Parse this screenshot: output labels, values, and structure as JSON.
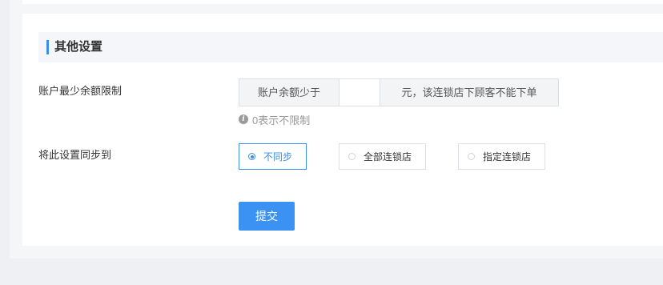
{
  "section": {
    "title": "其他设置"
  },
  "balance_limit": {
    "label": "账户最少余额限制",
    "prefix": "账户余额少于",
    "value": "",
    "suffix": "元，该连锁店下顾客不能下单",
    "hint": "0表示不限制"
  },
  "sync": {
    "label": "将此设置同步到",
    "selected": "不同步",
    "options": [
      "不同步",
      "全部连锁店",
      "指定连锁店"
    ]
  },
  "submit_label": "提交",
  "colors": {
    "accent": "#3b8fe8",
    "page_bg": "#eef0f3",
    "header_bg": "#f4f6f9"
  },
  "icons": {
    "hint": "info-icon"
  }
}
